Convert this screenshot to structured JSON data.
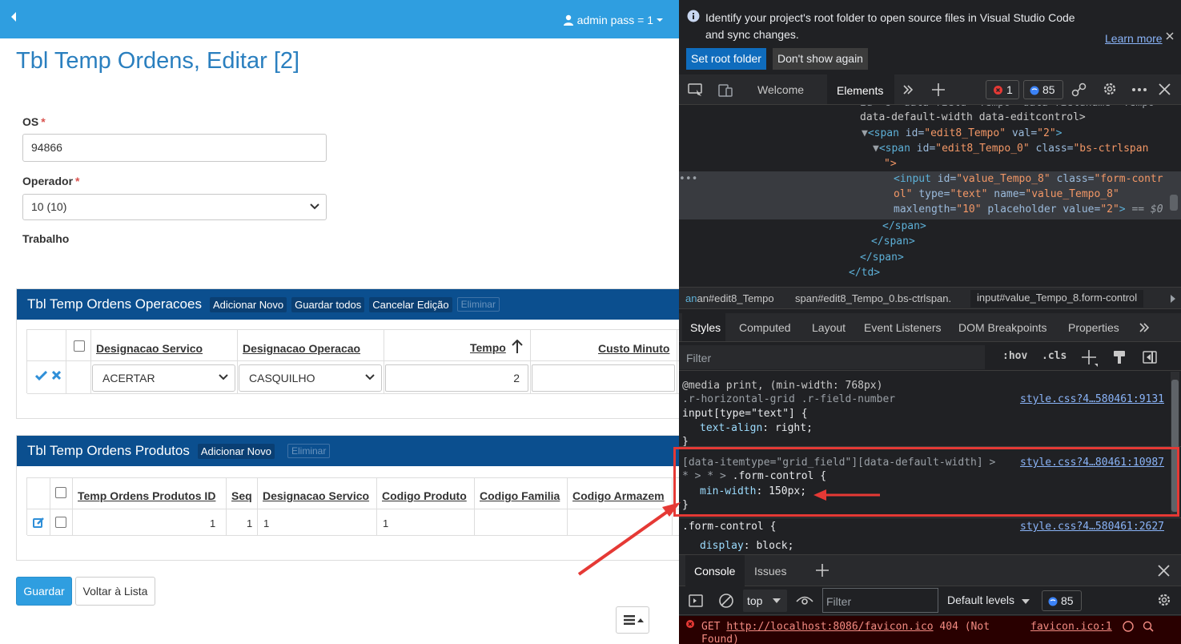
{
  "app": {
    "user_label": "admin pass = 1",
    "page_title": "Tbl Temp Ordens, Editar [2]",
    "form": {
      "os_label": "OS",
      "os_value": "94866",
      "operador_label": "Operador",
      "operador_value": "10 (10)",
      "trabalho_label": "Trabalho",
      "required_mark": "*"
    },
    "operacoes": {
      "title": "Tbl Temp Ordens Operacoes",
      "add_label": "Adicionar Novo",
      "save_all_label": "Guardar todos",
      "cancel_label": "Cancelar Edição",
      "delete_label": "Eliminar",
      "columns": [
        "Designacao Servico",
        "Designacao Operacao",
        "Tempo",
        "Custo Minuto"
      ],
      "row": {
        "servico": "ACERTAR",
        "operacao": "CASQUILHO",
        "tempo": "2"
      }
    },
    "produtos": {
      "title": "Tbl Temp Ordens Produtos",
      "add_label": "Adicionar Novo",
      "delete_label": "Eliminar",
      "columns": [
        "Temp Ordens Produtos ID",
        "Seq",
        "Designacao Servico",
        "Codigo Produto",
        "Codigo Familia",
        "Codigo Armazem"
      ],
      "row": [
        "1",
        "1",
        "1",
        "1"
      ]
    },
    "save_label": "Guardar",
    "back_list_label": "Voltar à Lista"
  },
  "devtools": {
    "info": {
      "message_line1": "Identify your project's root folder to open source files in Visual Studio Code",
      "message_line2": "and sync changes.",
      "learn_more": "Learn more",
      "set_root": "Set root folder",
      "dont_show": "Don't show again"
    },
    "tabs": {
      "welcome": "Welcome",
      "elements": "Elements"
    },
    "badges": {
      "errors": "1",
      "messages": "85"
    },
    "dom_lines": {
      "l0": "data-default-width data-editcontrol>",
      "l1_tag": "span",
      "l1_attr_id": "id",
      "l1_val_id": "\"edit8_Tempo\"",
      "l1_attr_val": "val",
      "l1_val_val": "\"2\"",
      "l2_attr_id": "id",
      "l2_val_id": "\"edit8_Tempo_0\"",
      "l2_attr_class": "class",
      "l2_val_class": "\"bs-ctrlspan",
      "l3": "\">",
      "l4_tag": "input",
      "l4_attr_id": "id",
      "l4_val_id": "\"value_Tempo_8\"",
      "l4_attr_class": "class",
      "l4_val_class": "\"form-contr",
      "l5_a": "ol\"",
      "l5_attr_type": "type",
      "l5_val_type": "\"text\"",
      "l5_attr_name": "name",
      "l5_val_name": "\"value_Tempo_8\"",
      "l6_attr_max": "maxlength",
      "l6_val_max": "\"10\"",
      "l6_attr_ph": "placeholder",
      "l6_attr_value": "value",
      "l6_val_value": "\"2\"",
      "l6_eq": "== $0",
      "close_span": "</span>",
      "close_td": "</td>"
    },
    "breadcrumbs": [
      "an#edit8_Tempo",
      "span#edit8_Tempo_0.bs-ctrlspan.",
      "input#value_Tempo_8.form-control"
    ],
    "style_tabs": [
      "Styles",
      "Computed",
      "Layout",
      "Event Listeners",
      "DOM Breakpoints",
      "Properties"
    ],
    "filter_placeholder": "Filter",
    "hov": ":hov",
    "cls": ".cls",
    "rules": {
      "r1_media": "@media print, (min-width: 768px)",
      "r1_sel1": ".r-horizontal-grid .r-field-number",
      "r1_sel2": "input[type=\"text\"] {",
      "r1_prop": "text-align",
      "r1_val": "right;",
      "r1_src": "style.css?4…580461:9131",
      "r2_sel1": "[data-itemtype=\"grid_field\"][data-default-width] >",
      "r2_sel2": "* > * > .form-control {",
      "r2_prop": "min-width",
      "r2_val": "150px;",
      "r2_src": "style.css?4…80461:10987",
      "r3_sel": ".form-control {",
      "r3_prop": "display",
      "r3_val": "block;",
      "r3_src": "style.css?4…580461:2627",
      "close": "}"
    },
    "console": {
      "tab_console": "Console",
      "tab_issues": "Issues",
      "context": "top",
      "filter_placeholder": "Filter",
      "levels": "Default levels",
      "count": "85",
      "error_prefix": "GET",
      "error_url": "http://localhost:8086/favicon.ico",
      "error_status": "404 (Not",
      "error_status2": "Found)",
      "error_src": "favicon.ico:1"
    },
    "colors": {
      "accent_red": "#e53935",
      "link_blue": "#8ab4f8"
    }
  }
}
